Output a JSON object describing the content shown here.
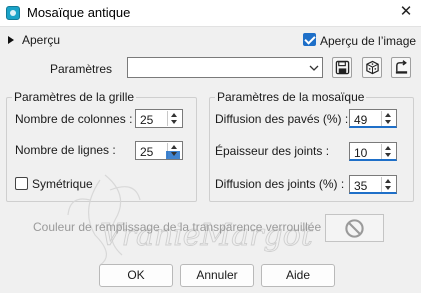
{
  "window": {
    "title": "Mosaïque antique",
    "close_glyph": "✕",
    "icon": "app-icon"
  },
  "preview": {
    "label": "Aperçu",
    "image_preview_label": "Aperçu de l’image",
    "image_preview_checked": true
  },
  "presets": {
    "label": "Paramètres",
    "value": "",
    "tools": [
      "save-icon",
      "random-dice-icon",
      "reset-icon"
    ]
  },
  "grid": {
    "title": "Paramètres de la grille",
    "columns_label": "Nombre de colonnes :",
    "columns_value": "25",
    "rows_label": "Nombre de lignes :",
    "rows_value": "25",
    "symmetric_label": "Symétrique",
    "symmetric_checked": false
  },
  "mosaic": {
    "title": "Paramètres de la mosaïque",
    "tile_diffusion_label": "Diffusion des pavés (%) :",
    "tile_diffusion_value": "49",
    "joint_thickness_label": "Épaisseur des joints :",
    "joint_thickness_value": "10",
    "joint_diffusion_label": "Diffusion des joints (%) :",
    "joint_diffusion_value": "35"
  },
  "transparency": {
    "label": "Couleur de remplissage de la transparence verrouillée :",
    "icon": "no-entry-icon"
  },
  "watermark": {
    "text": "VranieMargot"
  },
  "buttons": {
    "ok": "OK",
    "cancel": "Annuler",
    "help": "Aide"
  },
  "colors": {
    "accent": "#1e6fc8",
    "background": "#f0f0f0",
    "disabled_text": "#9a9a9a"
  }
}
